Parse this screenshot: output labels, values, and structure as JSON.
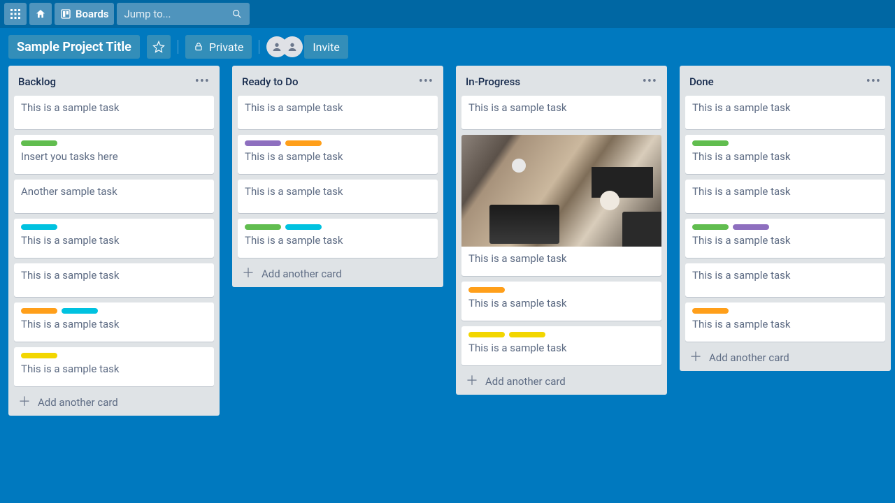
{
  "header": {
    "boards_label": "Boards",
    "search_placeholder": "Jump to..."
  },
  "board_header": {
    "title": "Sample Project Title",
    "visibility_label": "Private",
    "invite_label": "Invite"
  },
  "lists": [
    {
      "title": "Backlog",
      "add_label": "Add another card",
      "cards": [
        {
          "text": "This is a sample task",
          "labels": []
        },
        {
          "text": "Insert you tasks here",
          "labels": [
            "green"
          ]
        },
        {
          "text": "Another sample task",
          "labels": []
        },
        {
          "text": "This is a sample task",
          "labels": [
            "blue"
          ]
        },
        {
          "text": "This is a sample task",
          "labels": []
        },
        {
          "text": "This is a sample task",
          "labels": [
            "orange",
            "blue"
          ]
        },
        {
          "text": "This is a sample task",
          "labels": [
            "yellow"
          ]
        }
      ]
    },
    {
      "title": "Ready to Do",
      "add_label": "Add another card",
      "cards": [
        {
          "text": "This is a sample task",
          "labels": []
        },
        {
          "text": "This is a sample task",
          "labels": [
            "purple",
            "orange"
          ]
        },
        {
          "text": "This is a sample task",
          "labels": []
        },
        {
          "text": "This is a sample task",
          "labels": [
            "green",
            "blue"
          ]
        }
      ]
    },
    {
      "title": "In-Progress",
      "add_label": "Add another card",
      "cards": [
        {
          "text": "This is a sample task",
          "labels": []
        },
        {
          "text": "This is a sample task",
          "labels": [],
          "cover": true
        },
        {
          "text": "This is a sample task",
          "labels": [
            "orange"
          ]
        },
        {
          "text": "This is a sample task",
          "labels": [
            "yellow",
            "yellow"
          ]
        }
      ]
    },
    {
      "title": "Done",
      "add_label": "Add another card",
      "cards": [
        {
          "text": "This is a sample task",
          "labels": []
        },
        {
          "text": "This is a sample task",
          "labels": [
            "green"
          ]
        },
        {
          "text": "This is a sample task",
          "labels": []
        },
        {
          "text": "This is a sample task",
          "labels": [
            "green",
            "purple"
          ]
        },
        {
          "text": "This is a sample task",
          "labels": []
        },
        {
          "text": "This is a sample task",
          "labels": [
            "orange"
          ]
        }
      ]
    }
  ]
}
